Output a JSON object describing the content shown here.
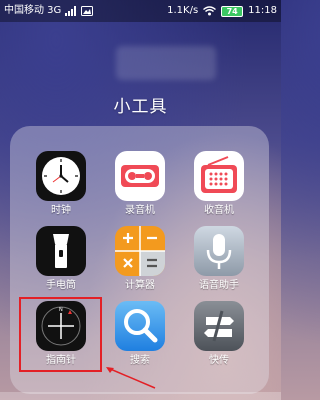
{
  "status_bar": {
    "carrier": "中国移动 3G",
    "speed": "1.1K/s",
    "battery": "74",
    "time": "11:18"
  },
  "folder": {
    "title": "小工具",
    "apps": [
      {
        "label": "时钟",
        "icon": "clock-icon"
      },
      {
        "label": "录音机",
        "icon": "recorder-icon"
      },
      {
        "label": "收音机",
        "icon": "radio-icon"
      },
      {
        "label": "手电筒",
        "icon": "flashlight-icon"
      },
      {
        "label": "计算器",
        "icon": "calculator-icon"
      },
      {
        "label": "语音助手",
        "icon": "microphone-icon"
      },
      {
        "label": "指南针",
        "icon": "compass-icon"
      },
      {
        "label": "搜索",
        "icon": "search-icon"
      },
      {
        "label": "快传",
        "icon": "share-icon"
      }
    ]
  },
  "colors": {
    "highlight": "#e32026",
    "recorder": "#f04a56",
    "radio": "#f04a56",
    "calculator": "#f39a1e",
    "search": "#2b8fea"
  }
}
